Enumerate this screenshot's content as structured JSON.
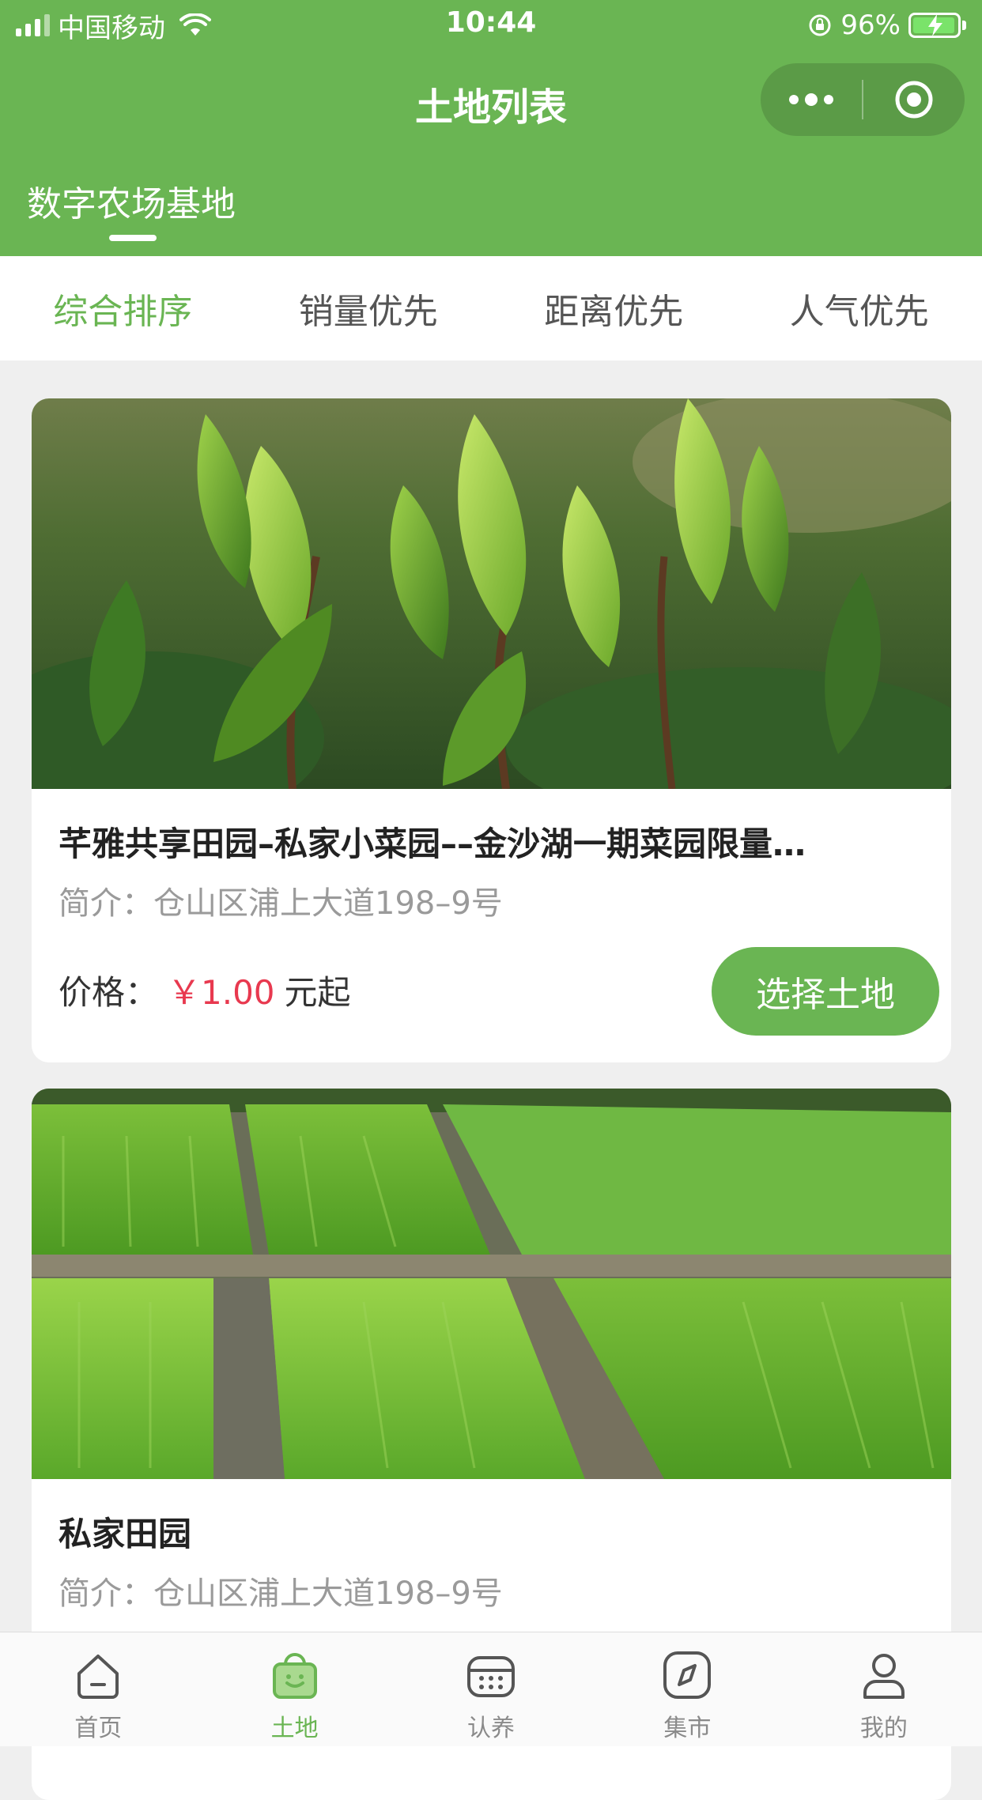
{
  "status_bar": {
    "carrier": "中国移动",
    "time": "10:44",
    "battery": "96%"
  },
  "nav": {
    "title": "土地列表"
  },
  "store_tab": {
    "label": "数字农场基地"
  },
  "sort_tabs": [
    {
      "label": "综合排序",
      "active": true
    },
    {
      "label": "销量优先",
      "active": false
    },
    {
      "label": "距离优先",
      "active": false
    },
    {
      "label": "人气优先",
      "active": false
    }
  ],
  "cards": [
    {
      "photo": "tea-leaves-photo",
      "title": "芊雅共享田园–私家小菜园––金沙湖一期菜园限量…",
      "intro": "简介：仓山区浦上大道198–9号",
      "price_label": "价格：",
      "price": "￥1.00",
      "price_unit": "元起",
      "button": "选择土地"
    },
    {
      "photo": "vegetable-beds-photo",
      "title": "私家田园",
      "intro": "简介：仓山区浦上大道198–9号"
    }
  ],
  "tab_bar": [
    {
      "label": "首页",
      "icon": "home-icon",
      "active": false
    },
    {
      "label": "土地",
      "icon": "land-bag-icon",
      "active": true
    },
    {
      "label": "认养",
      "icon": "calendar-icon",
      "active": false
    },
    {
      "label": "集市",
      "icon": "compass-icon",
      "active": false
    },
    {
      "label": "我的",
      "icon": "user-icon",
      "active": false
    }
  ],
  "colors": {
    "brand_green": "#6ab553",
    "price_red": "#e8394f",
    "background": "#efefef"
  }
}
